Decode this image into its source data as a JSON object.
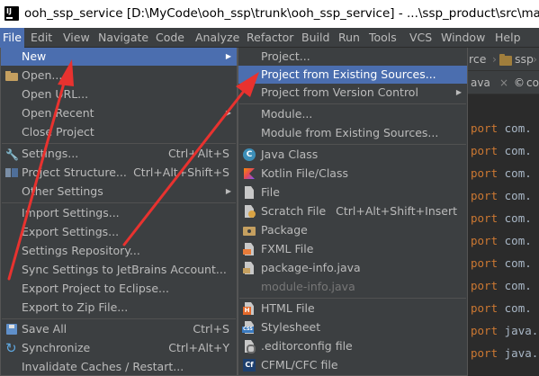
{
  "window": {
    "title": "ooh_ssp_service [D:\\MyCode\\ooh_ssp\\trunk\\ooh_ssp_service] - ...\\ssp_product\\src\\main\\java\\com\\"
  },
  "menubar": {
    "items": [
      "File",
      "Edit",
      "View",
      "Navigate",
      "Code",
      "Analyze",
      "Refactor",
      "Build",
      "Run",
      "Tools",
      "VCS",
      "Window",
      "Help"
    ],
    "active": "File"
  },
  "editor": {
    "breadcrumbs": [
      "rce",
      "ssp"
    ],
    "tabs": [
      "ava",
      "co"
    ],
    "code_lines": [
      {
        "kw": "port",
        "pkg": "com."
      },
      {
        "kw": "port",
        "pkg": "com."
      },
      {
        "kw": "port",
        "pkg": "com."
      },
      {
        "kw": "port",
        "pkg": "com."
      },
      {
        "kw": "port",
        "pkg": "com."
      },
      {
        "kw": "port",
        "pkg": "com."
      },
      {
        "kw": "port",
        "pkg": "com."
      },
      {
        "kw": "port",
        "pkg": "com."
      },
      {
        "kw": "port",
        "pkg": "com."
      },
      {
        "kw": "port",
        "pkg": "java."
      },
      {
        "kw": "port",
        "pkg": "java."
      }
    ]
  },
  "file_menu": {
    "items": [
      {
        "label": "New",
        "shortcut": "",
        "submenu": true,
        "highlighted": true
      },
      {
        "label": "Open...",
        "shortcut": "",
        "icon": "folder-icon"
      },
      {
        "label": "Open URL...",
        "shortcut": ""
      },
      {
        "label": "Open Recent",
        "shortcut": "",
        "submenu": true
      },
      {
        "label": "Close Project",
        "shortcut": ""
      },
      {
        "label": "Settings...",
        "shortcut": "Ctrl+Alt+S",
        "icon": "wrench-icon"
      },
      {
        "label": "Project Structure...",
        "shortcut": "Ctrl+Alt+Shift+S",
        "icon": "project-structure-icon"
      },
      {
        "label": "Other Settings",
        "shortcut": "",
        "submenu": true
      },
      {
        "label": "Import Settings...",
        "shortcut": ""
      },
      {
        "label": "Export Settings...",
        "shortcut": ""
      },
      {
        "label": "Settings Repository...",
        "shortcut": ""
      },
      {
        "label": "Sync Settings to JetBrains Account...",
        "shortcut": ""
      },
      {
        "label": "Export Project to Eclipse...",
        "shortcut": ""
      },
      {
        "label": "Export to Zip File...",
        "shortcut": ""
      },
      {
        "label": "Save All",
        "shortcut": "Ctrl+S",
        "icon": "save-icon"
      },
      {
        "label": "Synchronize",
        "shortcut": "Ctrl+Alt+Y",
        "icon": "sync-icon"
      },
      {
        "label": "Invalidate Caches / Restart...",
        "shortcut": ""
      }
    ]
  },
  "new_submenu": {
    "items": [
      {
        "label": "Project...",
        "shortcut": ""
      },
      {
        "label": "Project from Existing Sources...",
        "shortcut": "",
        "highlighted": true
      },
      {
        "label": "Project from Version Control",
        "shortcut": "",
        "submenu": true
      },
      {
        "label": "Module...",
        "shortcut": ""
      },
      {
        "label": "Module from Existing Sources...",
        "shortcut": ""
      },
      {
        "label": "Java Class",
        "shortcut": "",
        "icon": "java-class-icon"
      },
      {
        "label": "Kotlin File/Class",
        "shortcut": "",
        "icon": "kotlin-icon"
      },
      {
        "label": "File",
        "shortcut": "",
        "icon": "file-icon"
      },
      {
        "label": "Scratch File",
        "shortcut": "Ctrl+Alt+Shift+Insert",
        "icon": "scratch-file-icon"
      },
      {
        "label": "Package",
        "shortcut": "",
        "icon": "package-icon"
      },
      {
        "label": "FXML File",
        "shortcut": "",
        "icon": "fxml-file-icon"
      },
      {
        "label": "package-info.java",
        "shortcut": "",
        "icon": "package-info-icon"
      },
      {
        "label": "module-info.java",
        "shortcut": "",
        "disabled": true
      },
      {
        "label": "HTML File",
        "shortcut": "",
        "icon": "html-file-icon"
      },
      {
        "label": "Stylesheet",
        "shortcut": "",
        "icon": "stylesheet-icon"
      },
      {
        "label": ".editorconfig file",
        "shortcut": "",
        "icon": "editorconfig-icon"
      },
      {
        "label": "CFML/CFC file",
        "shortcut": "",
        "icon": "cfml-icon"
      }
    ]
  },
  "colors": {
    "menu_bg": "#3c3f41",
    "highlight": "#4b6eaf",
    "annotation_arrow": "#e8322f",
    "keyword": "#cc7832"
  }
}
